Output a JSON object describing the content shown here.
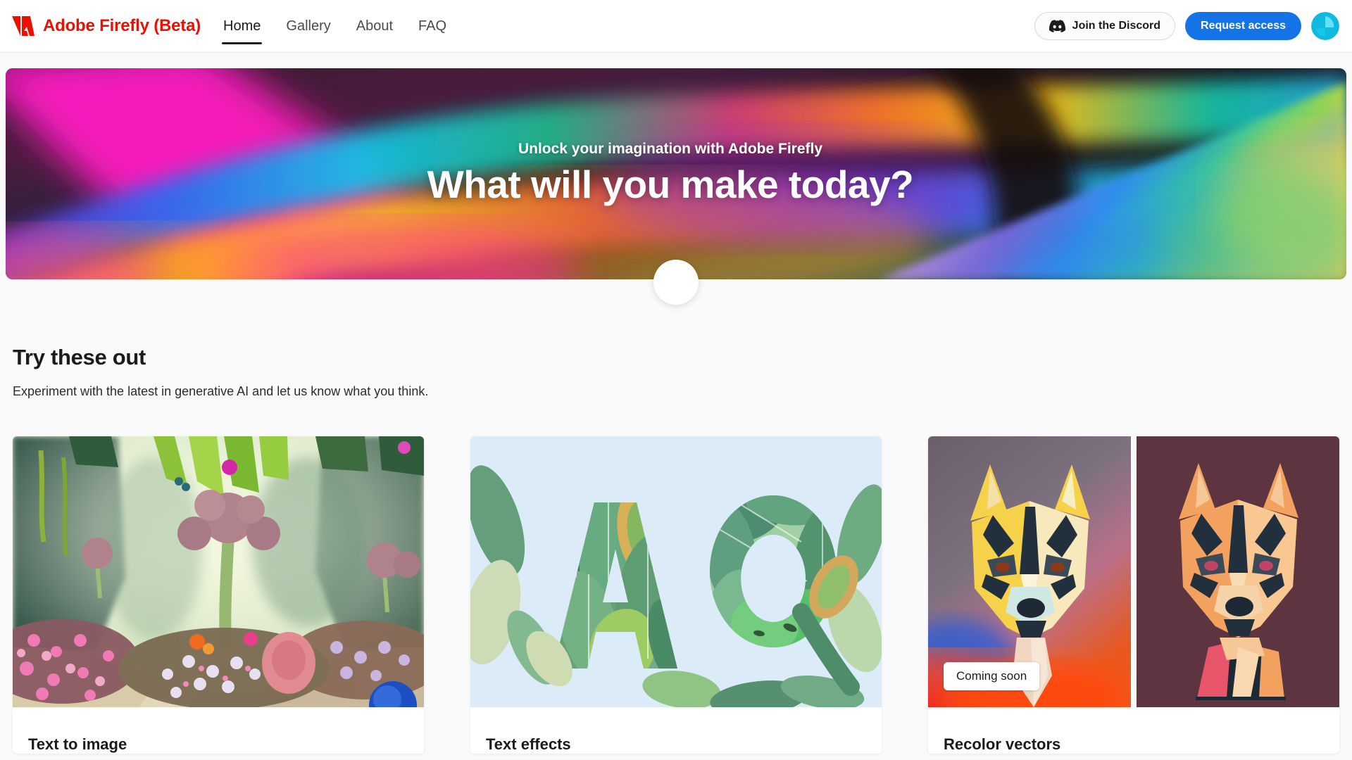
{
  "header": {
    "brand": {
      "name": "Adobe Firefly (Beta)",
      "logo_icon": "adobe-logo-icon",
      "color": "#eb1000"
    },
    "nav": [
      {
        "label": "Home",
        "active": true
      },
      {
        "label": "Gallery",
        "active": false
      },
      {
        "label": "About",
        "active": false
      },
      {
        "label": "FAQ",
        "active": false
      }
    ],
    "discord_button": {
      "label": "Join the Discord",
      "icon": "discord-icon"
    },
    "request_button": {
      "label": "Request access",
      "color": "#1473e6"
    },
    "avatar": {
      "icon": "user-avatar-icon",
      "color": "#11c8f0"
    }
  },
  "hero": {
    "subtitle": "Unlock your imagination with Adobe Firefly",
    "title": "What will you make today?",
    "scroll_button_icon": "scroll-down-circle-icon"
  },
  "main": {
    "section_title": "Try these out",
    "section_description": "Experiment with the latest in generative AI and let us know what you think.",
    "cards": [
      {
        "title": "Text to image",
        "image_alt": "surreal-fantasy-garden-image",
        "badge": null
      },
      {
        "title": "Text effects",
        "image_alt": "leafy-letters-AQ-image",
        "badge": null
      },
      {
        "title": "Recolor vectors",
        "image_alt": "geometric-dog-portraits-image",
        "badge": "Coming soon"
      }
    ]
  }
}
